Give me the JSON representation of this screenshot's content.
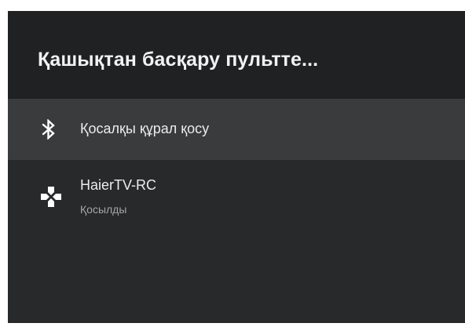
{
  "header": {
    "title": "Қашықтан басқару пультте..."
  },
  "add_accessory": {
    "icon": "bluetooth-icon",
    "label": "Қосалқы құрал қосу"
  },
  "device": {
    "icon": "gamepad-icon",
    "name": "HaierTV-RC",
    "status": "Қосылды"
  },
  "colors": {
    "panel_bg": "#28292b",
    "header_bg": "#202123",
    "selected_row_bg": "#3a3b3d",
    "text_primary": "#ececec",
    "text_secondary": "#a6a6a8"
  }
}
